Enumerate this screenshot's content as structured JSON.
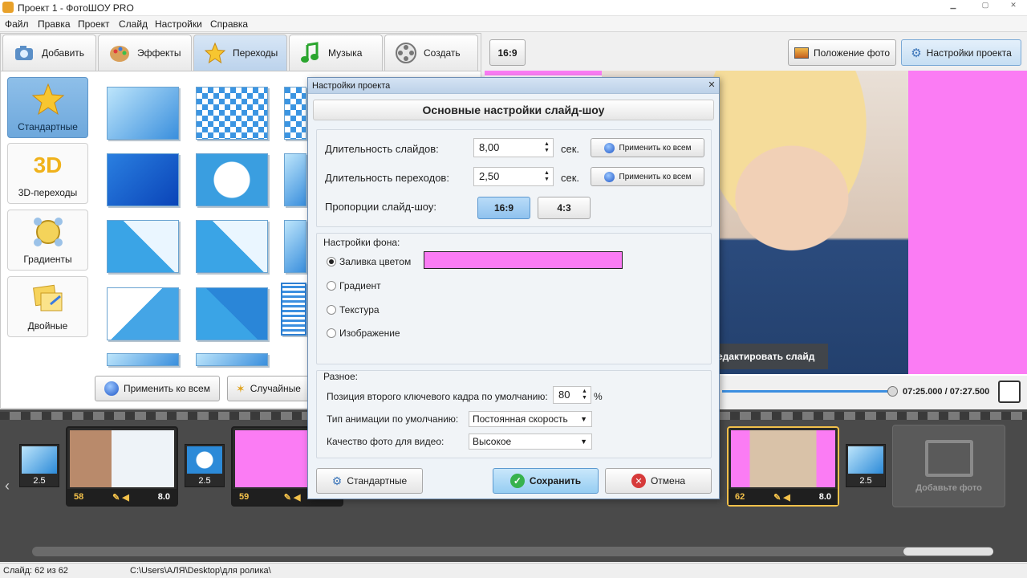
{
  "window": {
    "title": "Проект 1 - ФотоШОУ PRO"
  },
  "menu": [
    "Файл",
    "Правка",
    "Проект",
    "Слайд",
    "Настройки",
    "Справка"
  ],
  "tabs": [
    {
      "label": "Добавить",
      "icon": "camera-icon"
    },
    {
      "label": "Эффекты",
      "icon": "palette-icon"
    },
    {
      "label": "Переходы",
      "icon": "star-icon",
      "active": true
    },
    {
      "label": "Музыка",
      "icon": "music-note-icon"
    },
    {
      "label": "Создать",
      "icon": "film-reel-icon"
    }
  ],
  "categories": [
    {
      "label": "Стандартные",
      "icon": "star-icon",
      "active": true
    },
    {
      "label": "3D-переходы",
      "icon": "3d-icon",
      "icon_text": "3D"
    },
    {
      "label": "Градиенты",
      "icon": "gradient-icon"
    },
    {
      "label": "Двойные",
      "icon": "double-icon"
    }
  ],
  "transition_actions": {
    "apply_all": "Применить ко всем",
    "random": "Случайные"
  },
  "preview": {
    "ratio": "16:9",
    "photo_position": "Положение фото",
    "project_settings": "Настройки проекта",
    "edit_slide": "едактировать слайд",
    "time": "07:25.000 / 07:27.500",
    "progress": 0.9
  },
  "filmstrip": {
    "slides": [
      {
        "num": "58",
        "duration": "8.0"
      },
      {
        "num": "59",
        "duration": ""
      },
      {
        "num": "62",
        "duration": "8.0"
      }
    ],
    "transitions": [
      "2.5",
      "2.5",
      "2.5"
    ],
    "add_photo": "Добавьте фото"
  },
  "status": {
    "slide": "Слайд: 62 из 62",
    "path": "C:\\Users\\АЛЯ\\Desktop\\для ролика\\"
  },
  "dialog": {
    "title": "Настройки проекта",
    "header": "Основные настройки слайд-шоу",
    "slide_duration": {
      "label": "Длительность слайдов:",
      "value": "8,00",
      "unit": "сек.",
      "apply": "Применить ко всем"
    },
    "transition_duration": {
      "label": "Длительность переходов:",
      "value": "2,50",
      "unit": "сек.",
      "apply": "Применить ко всем"
    },
    "aspect": {
      "label": "Пропорции слайд-шоу:",
      "options": [
        "16:9",
        "4:3"
      ],
      "selected": "16:9"
    },
    "background": {
      "title": "Настройки фона:",
      "options": [
        "Заливка цветом",
        "Градиент",
        "Текстура",
        "Изображение"
      ],
      "selected": "Заливка цветом",
      "fill_color": "#fb7cf4"
    },
    "misc": {
      "title": "Разное:",
      "keyframe_label": "Позиция второго ключевого кадра по умолчанию:",
      "keyframe_value": "80",
      "keyframe_unit": "%",
      "anim_label": "Тип анимации по умолчанию:",
      "anim_value": "Постоянная скорость",
      "quality_label": "Качество фото для видео:",
      "quality_value": "Высокое"
    },
    "buttons": {
      "defaults": "Стандартные",
      "save": "Сохранить",
      "cancel": "Отмена"
    }
  }
}
